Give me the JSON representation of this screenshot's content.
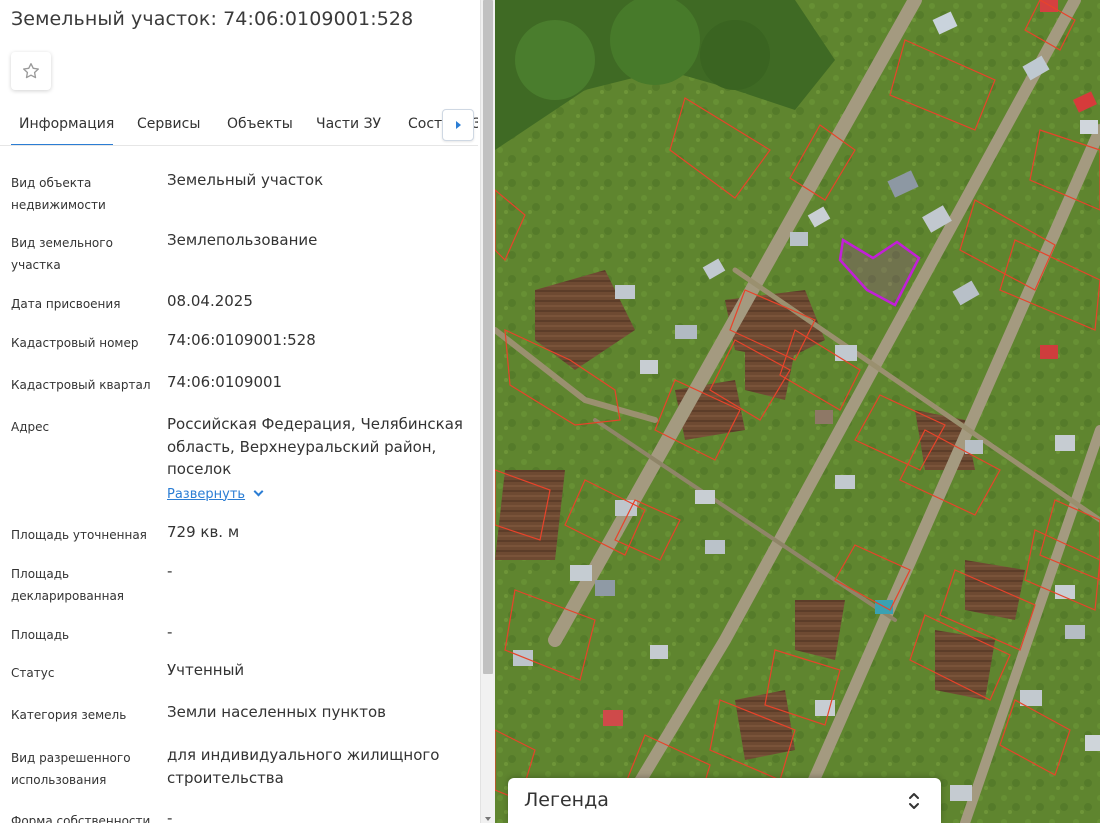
{
  "header": {
    "title": "Земельный участок: 74:06:0109001:528"
  },
  "tabs": [
    {
      "label": "Информация",
      "active": true
    },
    {
      "label": "Сервисы"
    },
    {
      "label": "Объекты"
    },
    {
      "label": "Части ЗУ"
    },
    {
      "label": "Состав ЕЗП"
    }
  ],
  "fields": {
    "object_type": {
      "label": "Вид объекта недвижимости",
      "value": "Земельный участок"
    },
    "parcel_type": {
      "label": "Вид земельного участка",
      "value": "Землепользование"
    },
    "assign_date": {
      "label": "Дата присвоения",
      "value": "08.04.2025"
    },
    "cad_number": {
      "label": "Кадастровый номер",
      "value": "74:06:0109001:528"
    },
    "cad_quarter": {
      "label": "Кадастровый квартал",
      "value": "74:06:0109001"
    },
    "address": {
      "label": "Адрес",
      "value": "Российская Федерация, Челябинская область, Верхнеуральский район, поселок",
      "expand": "Развернуть"
    },
    "area_refined": {
      "label": "Площадь уточненная",
      "value": "729 кв. м"
    },
    "area_declared": {
      "label": "Площадь декларированная",
      "value": "-"
    },
    "area": {
      "label": "Площадь",
      "value": "-"
    },
    "status": {
      "label": "Статус",
      "value": "Учтенный"
    },
    "land_category": {
      "label": "Категория земель",
      "value": "Земли населенных пунктов"
    },
    "permitted_use": {
      "label": "Вид разрешенного использования",
      "value": "для индивидуального жилищного строительства"
    },
    "ownership": {
      "label": "Форма собственности",
      "value": "-"
    }
  },
  "legend": {
    "label": "Легенда"
  },
  "colors": {
    "accent": "#2b7dd4",
    "parcel_border": "#e8432a",
    "selected_parcel": "#c21fd8"
  },
  "icons": {
    "favorite": "star-outline-icon",
    "tabs_next": "caret-right-icon",
    "expand": "chevron-down-icon",
    "legend_toggle": "unfold-icon"
  }
}
